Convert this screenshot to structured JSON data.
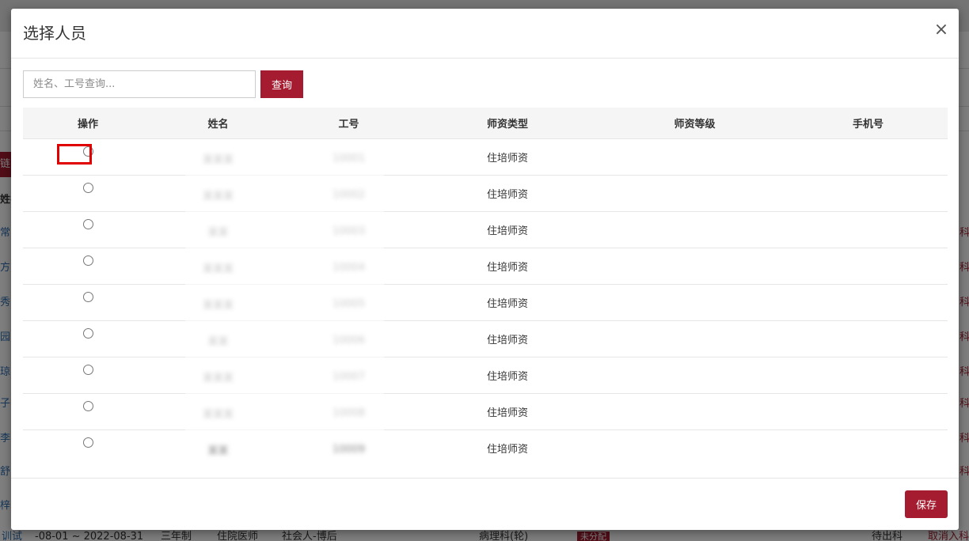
{
  "background": {
    "left_column_chars": [
      "链",
      "姓名",
      "常",
      "方",
      "秀",
      "园",
      "琼",
      "子",
      "李",
      "舒",
      "梓"
    ],
    "right_column_chars": [
      "科",
      "科",
      "科",
      "科",
      "科",
      "科",
      "科",
      "科"
    ],
    "bottom_row": {
      "c0": "训试",
      "c1": "-08-01 ~ 2022-08-31",
      "c2": "三年制",
      "c3": "住院医师",
      "c4": "社会人-博后",
      "c5": "病理科(轮)",
      "c6": "未分配",
      "c7": "待出科",
      "c8": "取消入科"
    }
  },
  "modal": {
    "title": "选择人员",
    "close_icon": "close-icon",
    "search": {
      "placeholder": "姓名、工号查询...",
      "value": "",
      "button_label": "查询"
    },
    "table": {
      "headers": [
        "操作",
        "姓名",
        "工号",
        "师资类型",
        "师资等级",
        "手机号"
      ],
      "rows": [
        {
          "name": "某某某",
          "id": "10001",
          "type": "住培师资",
          "level": "",
          "phone": ""
        },
        {
          "name": "某某某",
          "id": "10002",
          "type": "住培师资",
          "level": "",
          "phone": ""
        },
        {
          "name": "某某",
          "id": "10003",
          "type": "住培师资",
          "level": "",
          "phone": ""
        },
        {
          "name": "某某某",
          "id": "10004",
          "type": "住培师资",
          "level": "",
          "phone": ""
        },
        {
          "name": "某某某",
          "id": "10005",
          "type": "住培师资",
          "level": "",
          "phone": ""
        },
        {
          "name": "某某",
          "id": "10006",
          "type": "住培师资",
          "level": "",
          "phone": ""
        },
        {
          "name": "某某某",
          "id": "10007",
          "type": "住培师资",
          "level": "",
          "phone": ""
        },
        {
          "name": "某某某",
          "id": "10008",
          "type": "住培师资",
          "level": "",
          "phone": ""
        },
        {
          "name": "某某",
          "id": "10009",
          "type": "住培师资",
          "level": "",
          "phone": ""
        }
      ]
    },
    "footer": {
      "save_label": "保存"
    }
  },
  "colors": {
    "accent": "#a51c30",
    "overlay": "rgba(0,0,0,0.5)",
    "highlight": "#e00000"
  }
}
